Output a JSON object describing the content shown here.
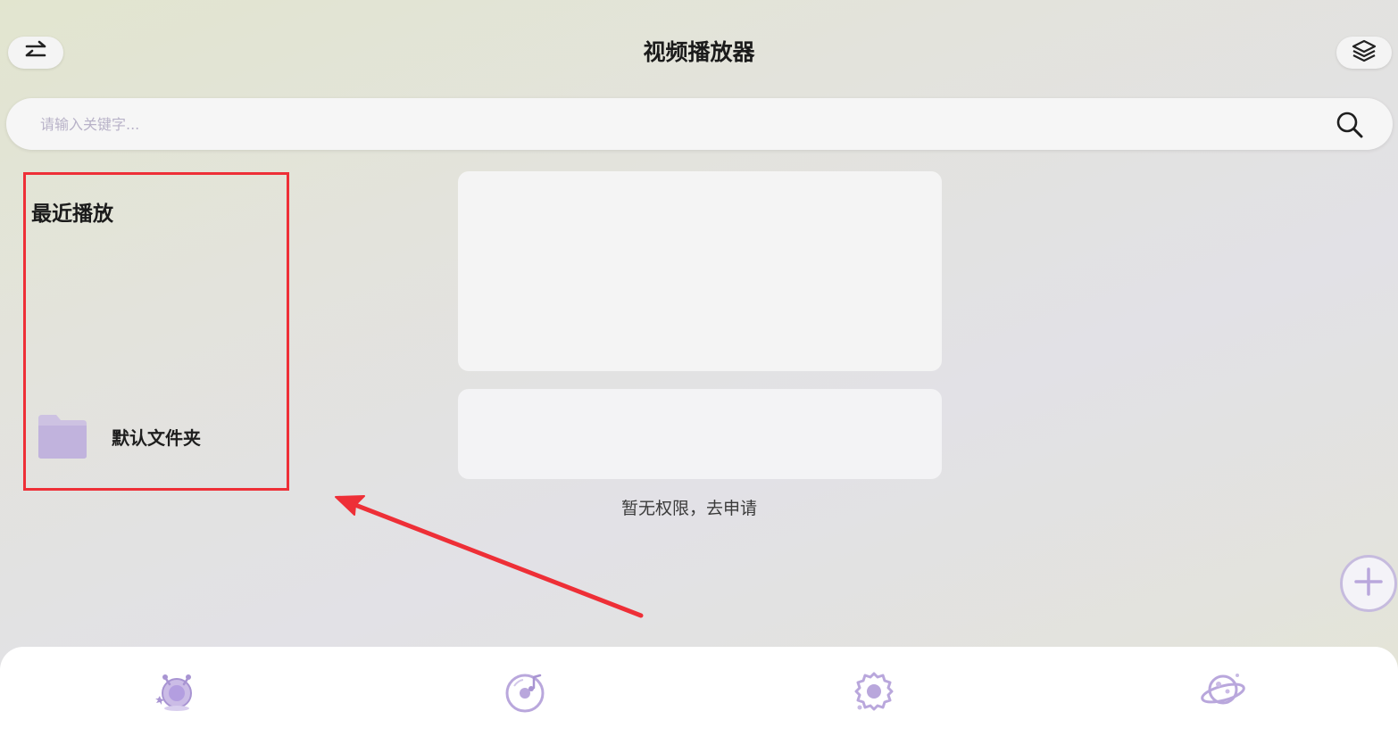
{
  "header": {
    "title": "视频播放器",
    "switch_icon": "swap-arrows-icon",
    "layers_icon": "layers-icon"
  },
  "search": {
    "placeholder": "请输入关键字...",
    "value": "",
    "icon": "search-icon"
  },
  "recent": {
    "title": "最近播放",
    "folders": [
      {
        "label": "默认文件夹",
        "icon": "folder-icon"
      }
    ]
  },
  "main": {
    "permission_text": "暂无权限，去申请"
  },
  "fab": {
    "icon": "plus-icon"
  },
  "bottom_nav": {
    "items": [
      {
        "icon": "alien-planet-icon"
      },
      {
        "icon": "music-disc-icon"
      },
      {
        "icon": "gear-icon"
      },
      {
        "icon": "planet-icon"
      }
    ]
  },
  "colors": {
    "accent": "#b9a7dc",
    "highlight_border": "#ee2f37",
    "annotation_arrow": "#ee2f37",
    "nav_background": "#ffffff"
  }
}
